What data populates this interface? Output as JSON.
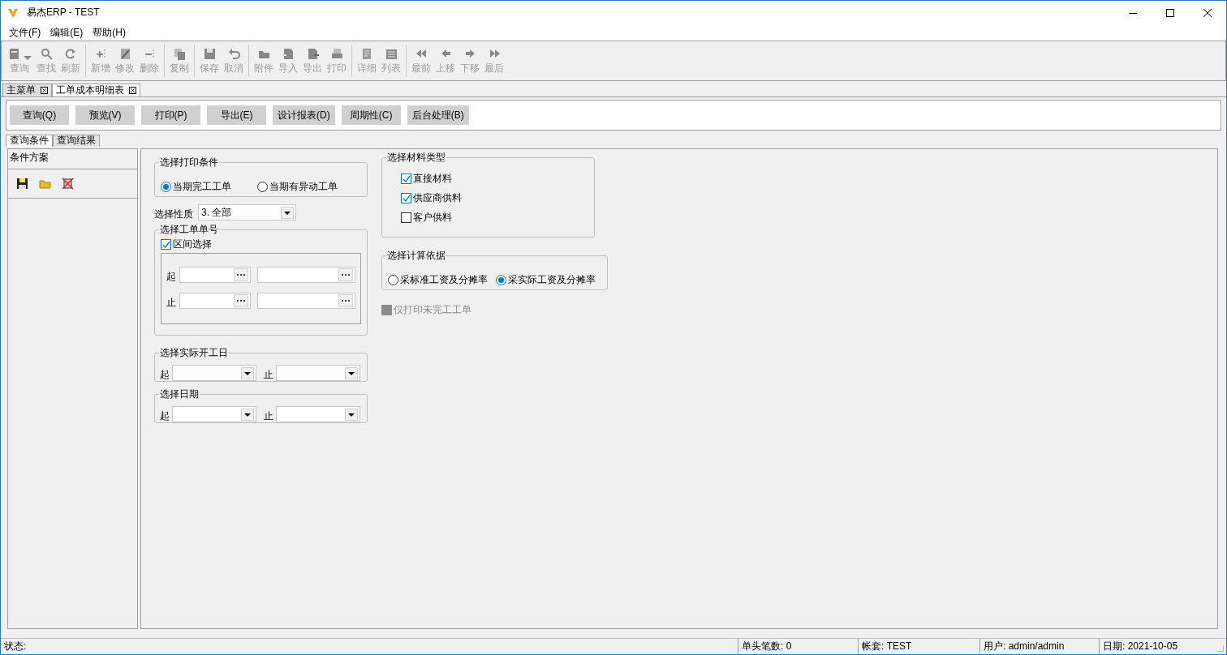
{
  "window": {
    "title": "易杰ERP - TEST"
  },
  "menu": [
    "文件(F)",
    "编辑(E)",
    "帮助(H)"
  ],
  "toolbar_groups": [
    {
      "items": [
        {
          "label": "查询",
          "disabled": true,
          "dropdown": true
        },
        {
          "label": "查找",
          "disabled": true
        },
        {
          "label": "刷新",
          "disabled": true
        }
      ]
    },
    {
      "items": [
        {
          "label": "新增",
          "disabled": true
        },
        {
          "label": "修改",
          "disabled": true
        },
        {
          "label": "删除",
          "disabled": true
        }
      ]
    },
    {
      "items": [
        {
          "label": "复制",
          "disabled": true
        }
      ]
    },
    {
      "items": [
        {
          "label": "保存",
          "disabled": true
        },
        {
          "label": "取消",
          "disabled": true
        }
      ]
    },
    {
      "items": [
        {
          "label": "附件",
          "disabled": true
        },
        {
          "label": "导入",
          "disabled": true
        },
        {
          "label": "导出",
          "disabled": true
        },
        {
          "label": "打印",
          "disabled": true
        }
      ]
    },
    {
      "items": [
        {
          "label": "详细",
          "disabled": true
        },
        {
          "label": "列表",
          "disabled": true
        }
      ]
    },
    {
      "items": [
        {
          "label": "最前",
          "disabled": true
        },
        {
          "label": "上移",
          "disabled": true
        },
        {
          "label": "下移",
          "disabled": true
        },
        {
          "label": "最后",
          "disabled": true
        }
      ]
    }
  ],
  "document_tabs": [
    {
      "label": "主菜单",
      "selected": false
    },
    {
      "label": "工单成本明细表",
      "selected": true
    }
  ],
  "action_buttons": [
    "查询(Q)",
    "预览(V)",
    "打印(P)",
    "导出(E)",
    "设计报表(D)",
    "周期性(C)",
    "后台处理(B)"
  ],
  "sub_tabs": [
    {
      "label": "查询条件",
      "selected": true
    },
    {
      "label": "查询结果",
      "selected": false
    }
  ],
  "scheme_panel": {
    "title": "条件方案"
  },
  "print_condition": {
    "title": "选择打印条件",
    "options": [
      {
        "label": "当期完工工单",
        "selected": true
      },
      {
        "label": "当期有异动工单",
        "selected": false
      }
    ]
  },
  "nature": {
    "label": "选择性质",
    "value": "3. 全部"
  },
  "order_number": {
    "title": "选择工单单号",
    "range": {
      "label": "区间选择",
      "checked": true
    },
    "rows": [
      "起",
      "止"
    ]
  },
  "start_date": {
    "title": "选择实际开工日",
    "from_label": "起",
    "to_label": "止"
  },
  "date": {
    "title": "选择日期",
    "from_label": "起",
    "to_label": "止"
  },
  "material_type": {
    "title": "选择材料类型",
    "options": [
      {
        "label": "直接材料",
        "checked": true
      },
      {
        "label": "供应商供料",
        "checked": true
      },
      {
        "label": "客户供料",
        "checked": false
      }
    ]
  },
  "calc_basis": {
    "title": "选择计算依据",
    "options": [
      {
        "label": "采标准工资及分摊率",
        "selected": false
      },
      {
        "label": "采实际工资及分摊率",
        "selected": true
      }
    ]
  },
  "unfinished_only": {
    "label": "仅打印未完工工单",
    "disabled": true
  },
  "status_bar": [
    "状态:",
    "单头笔数: 0",
    "帐套: TEST",
    "用户: admin/admin",
    "日期: 2021-10-05"
  ]
}
